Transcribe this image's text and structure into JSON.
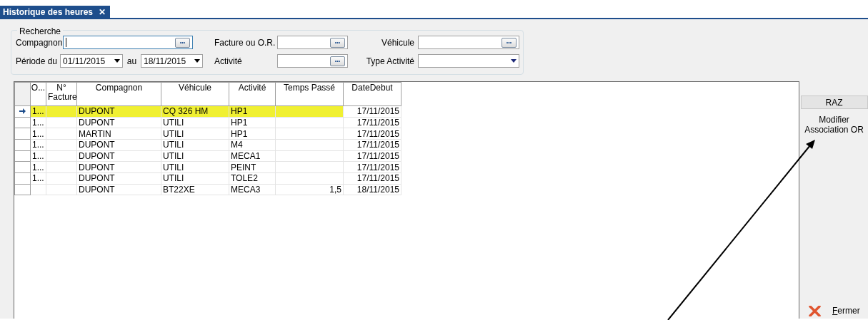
{
  "tab": {
    "title": "Historique des heures",
    "close": "✕"
  },
  "search": {
    "legend": "Recherche",
    "fields": [
      {
        "label": "Compagnon",
        "kind": "lookup",
        "focused": true
      },
      {
        "label": "Facture ou O.R.",
        "kind": "lookup",
        "focused": false
      },
      {
        "label": "Véhicule",
        "kind": "lookup",
        "focused": false
      },
      {
        "label": "Période du",
        "kind": "date",
        "value": "01/11/2015"
      },
      {
        "label": "au",
        "kind": "date",
        "value": "18/11/2015"
      },
      {
        "label": "Activité",
        "kind": "lookup",
        "focused": false
      },
      {
        "label": "Type Activité",
        "kind": "combo"
      }
    ],
    "lookup_button": "•••"
  },
  "grid": {
    "columns": [
      "O...",
      "N° Facture",
      "Compagnon",
      "Véhicule",
      "Activité",
      "Temps Passé",
      "DateDebut"
    ],
    "rows": [
      {
        "selected": true,
        "o": "1...",
        "compagnon": "DUPONT",
        "vehicule": "CQ 326 HM",
        "activite": "HP1",
        "date": "17/11/2015"
      },
      {
        "selected": false,
        "o": "1...",
        "compagnon": "DUPONT",
        "vehicule": "UTILI",
        "activite": "HP1",
        "date": "17/11/2015"
      },
      {
        "selected": false,
        "o": "1...",
        "compagnon": "MARTIN",
        "vehicule": "UTILI",
        "activite": "HP1",
        "date": "17/11/2015"
      },
      {
        "selected": false,
        "o": "1...",
        "compagnon": "DUPONT",
        "vehicule": "UTILI",
        "activite": "M4",
        "date": "17/11/2015"
      },
      {
        "selected": false,
        "o": "1...",
        "compagnon": "DUPONT",
        "vehicule": "UTILI",
        "activite": "MECA1",
        "date": "17/11/2015"
      },
      {
        "selected": false,
        "o": "1...",
        "compagnon": "DUPONT",
        "vehicule": "UTILI",
        "activite": "PEINT",
        "date": "17/11/2015"
      },
      {
        "selected": false,
        "o": "1...",
        "compagnon": "DUPONT",
        "vehicule": "UTILI",
        "activite": "TOLE2",
        "date": "17/11/2015"
      },
      {
        "selected": false,
        "compagnon": "DUPONT",
        "vehicule": "BT22XE",
        "activite": "MECA3",
        "temps": "1,5",
        "date": "18/11/2015"
      }
    ]
  },
  "actions": {
    "reset": "RAZ",
    "modify": "Modifier Association OR",
    "close": "Fermer"
  }
}
